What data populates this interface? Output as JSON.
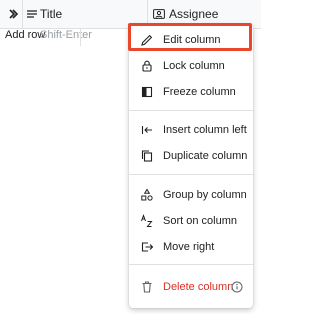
{
  "header": {
    "title_column": "Title",
    "assignee_column": "Assignee",
    "expand_icon": "chevron-double-right-icon",
    "title_icon": "text-lines-icon",
    "assignee_icon": "person-card-icon"
  },
  "grid": {
    "add_row_label": "Add row",
    "add_row_hint": "Shift-Enter"
  },
  "menu": {
    "items": [
      {
        "label": "Edit column",
        "icon": "pencil-icon",
        "highlighted": true
      },
      {
        "label": "Lock column",
        "icon": "lock-icon"
      },
      {
        "label": "Freeze column",
        "icon": "freeze-icon"
      },
      {
        "label": "Insert column left",
        "icon": "insert-left-icon"
      },
      {
        "label": "Duplicate column",
        "icon": "duplicate-icon"
      },
      {
        "label": "Group by column",
        "icon": "group-shapes-icon"
      },
      {
        "label": "Sort on column",
        "icon": "sort-az-icon"
      },
      {
        "label": "Move right",
        "icon": "move-right-icon"
      },
      {
        "label": "Delete column",
        "icon": "trash-icon",
        "info_icon": "info-icon",
        "danger": true
      }
    ]
  },
  "colors": {
    "highlight_border": "#e8472c",
    "danger_text": "#d93025"
  }
}
